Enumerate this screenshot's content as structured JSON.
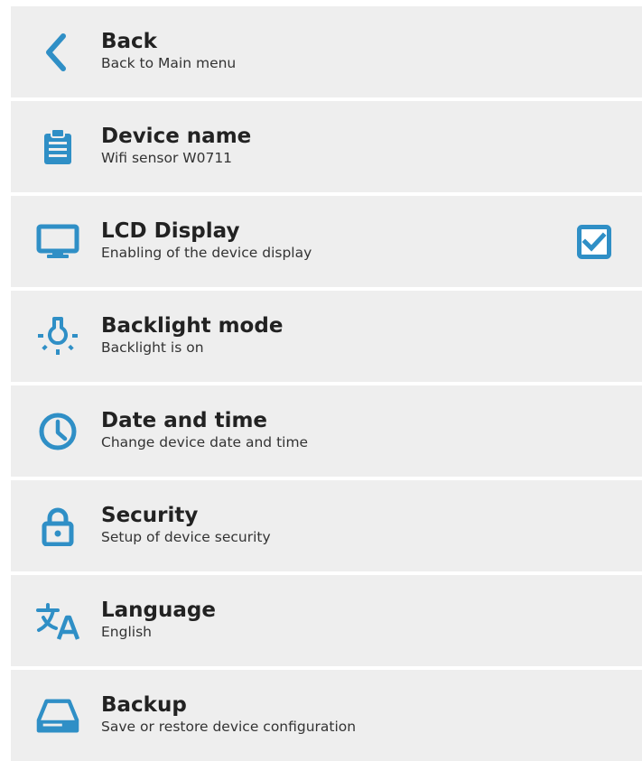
{
  "accent_color": "#2f8fc6",
  "menu": {
    "items": [
      {
        "icon": "chevron-left-icon",
        "title": "Back",
        "subtitle": "Back to Main menu"
      },
      {
        "icon": "clipboard-icon",
        "title": "Device name",
        "subtitle": "Wifi sensor W0711"
      },
      {
        "icon": "monitor-icon",
        "title": "LCD Display",
        "subtitle": "Enabling of the device display",
        "checked": true
      },
      {
        "icon": "lightbulb-icon",
        "title": "Backlight mode",
        "subtitle": "Backlight is on"
      },
      {
        "icon": "clock-icon",
        "title": "Date and time",
        "subtitle": "Change device date and time"
      },
      {
        "icon": "lock-icon",
        "title": "Security",
        "subtitle": "Setup of device security"
      },
      {
        "icon": "translate-icon",
        "title": "Language",
        "subtitle": "English"
      },
      {
        "icon": "backup-drive-icon",
        "title": "Backup",
        "subtitle": "Save or restore device configuration"
      }
    ]
  }
}
